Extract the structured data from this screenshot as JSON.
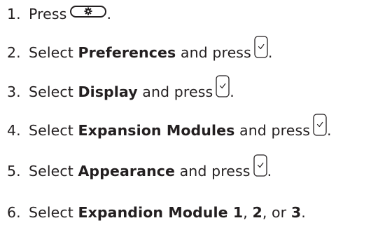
{
  "steps": [
    {
      "num": "1.",
      "pre": "Press",
      "icon": "settings-button-icon",
      "post": "."
    },
    {
      "num": "2.",
      "pre": "Select ",
      "bold": "Preferences",
      "mid": " and press",
      "icon": "ok-button-icon",
      "post": "."
    },
    {
      "num": "3.",
      "pre": "Select ",
      "bold": "Display",
      "mid": " and press",
      "icon": "ok-button-icon",
      "post": "."
    },
    {
      "num": "4.",
      "pre": "Select ",
      "bold": "Expansion Modules",
      "mid": " and press",
      "icon": "ok-button-icon",
      "post": "."
    },
    {
      "num": "5.",
      "pre": "Select ",
      "bold": "Appearance",
      "mid": " and press",
      "icon": "ok-button-icon",
      "post": "."
    },
    {
      "num": "6.",
      "pre": "Select ",
      "bold": "Expandion Module 1",
      "sep1": ", ",
      "bold2": "2",
      "sep2": ", or ",
      "bold3": "3",
      "post": "."
    }
  ]
}
